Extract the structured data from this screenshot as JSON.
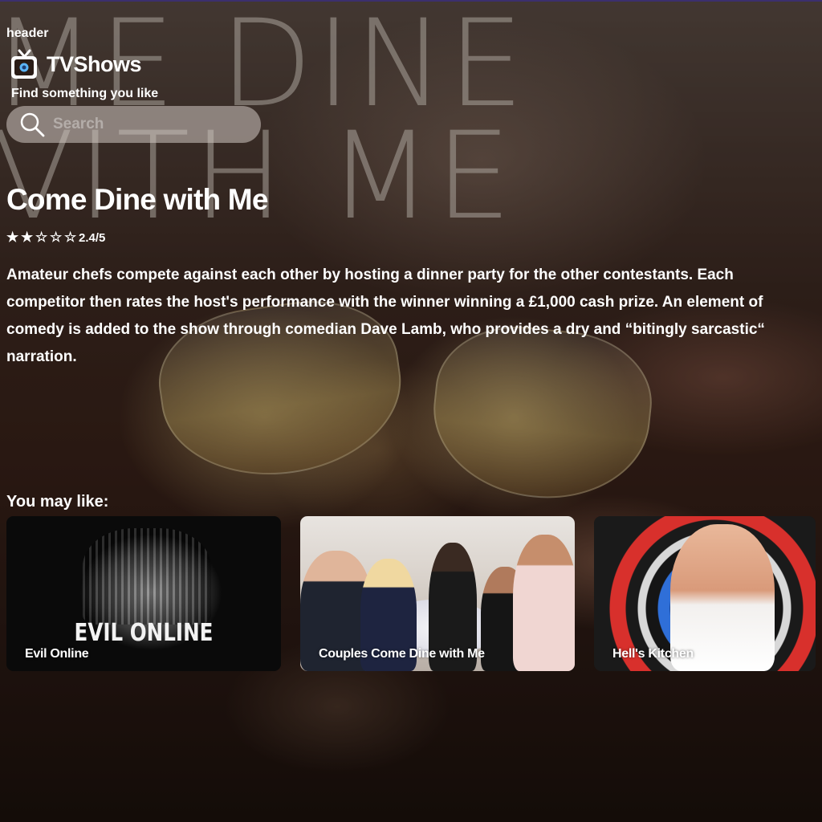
{
  "header": {
    "label": "header",
    "brand_name": "TVShows",
    "tagline": "Find something you like",
    "icon": "tv-icon"
  },
  "search": {
    "placeholder": "Search",
    "value": "",
    "icon": "search-icon"
  },
  "show": {
    "title": "Come Dine with Me",
    "rating_value": 2.4,
    "rating_text": "2.4/5",
    "stars": [
      "★",
      "★",
      "☆",
      "☆",
      "☆"
    ],
    "description": "Amateur chefs compete against each other by hosting a dinner party for the other contestants. Each competitor then rates the host's performance with the winner winning a £1,000 cash prize. An element of comedy is added to the show through comedian Dave Lamb, who provides a dry and “bitingly sarcastic“ narration."
  },
  "recommendations": {
    "heading": "You may like:",
    "items": [
      {
        "title": "Evil Online",
        "poster_text": "EVIL ONLINE"
      },
      {
        "title": "Couples Come Dine with Me"
      },
      {
        "title": "Hell's Kitchen"
      }
    ]
  },
  "colors": {
    "text": "#ffffff",
    "search_bg": "#d2c8c3",
    "top_border": "#3b2f6e"
  }
}
